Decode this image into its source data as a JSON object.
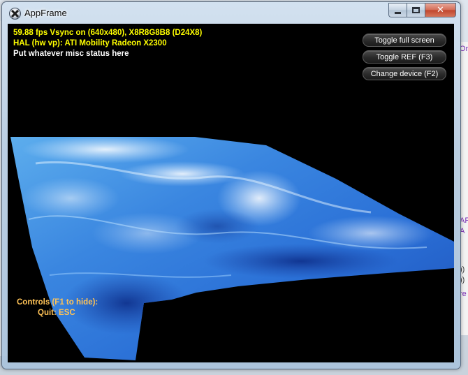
{
  "window": {
    "title": "AppFrame"
  },
  "status": {
    "line1": "59.88 fps Vsync on (640x480), X8R8G8B8 (D24X8)",
    "line2": "HAL (hw vp): ATI Mobility Radeon X2300",
    "line3": "Put whatever misc status here"
  },
  "buttons": {
    "toggle_fullscreen": "Toggle full screen",
    "toggle_ref": "Toggle REF (F3)",
    "change_device": "Change device (F2)"
  },
  "controls_help": {
    "heading": "Controls (F1 to hide):",
    "quit": "Quit: ESC"
  },
  "colors": {
    "status_yellow": "#ffff00",
    "status_white": "#ffffff",
    "controls_orange": "#ffc357",
    "background": "#000000"
  },
  "icons": [
    "app-icon",
    "minimize-icon",
    "maximize-icon",
    "close-icon"
  ]
}
